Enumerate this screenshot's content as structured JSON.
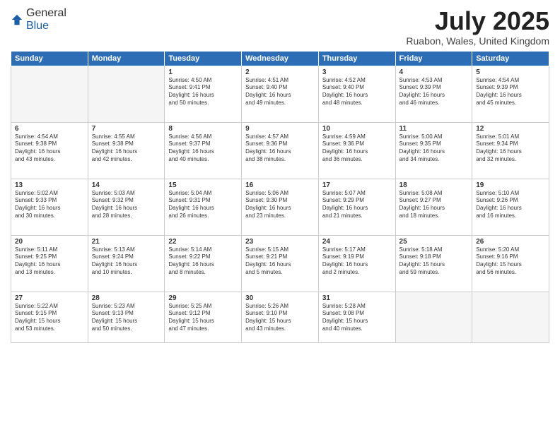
{
  "header": {
    "logo_general": "General",
    "logo_blue": "Blue",
    "title": "July 2025",
    "subtitle": "Ruabon, Wales, United Kingdom"
  },
  "days_of_week": [
    "Sunday",
    "Monday",
    "Tuesday",
    "Wednesday",
    "Thursday",
    "Friday",
    "Saturday"
  ],
  "weeks": [
    [
      {
        "day": "",
        "info": ""
      },
      {
        "day": "",
        "info": ""
      },
      {
        "day": "1",
        "info": "Sunrise: 4:50 AM\nSunset: 9:41 PM\nDaylight: 16 hours\nand 50 minutes."
      },
      {
        "day": "2",
        "info": "Sunrise: 4:51 AM\nSunset: 9:40 PM\nDaylight: 16 hours\nand 49 minutes."
      },
      {
        "day": "3",
        "info": "Sunrise: 4:52 AM\nSunset: 9:40 PM\nDaylight: 16 hours\nand 48 minutes."
      },
      {
        "day": "4",
        "info": "Sunrise: 4:53 AM\nSunset: 9:39 PM\nDaylight: 16 hours\nand 46 minutes."
      },
      {
        "day": "5",
        "info": "Sunrise: 4:54 AM\nSunset: 9:39 PM\nDaylight: 16 hours\nand 45 minutes."
      }
    ],
    [
      {
        "day": "6",
        "info": "Sunrise: 4:54 AM\nSunset: 9:38 PM\nDaylight: 16 hours\nand 43 minutes."
      },
      {
        "day": "7",
        "info": "Sunrise: 4:55 AM\nSunset: 9:38 PM\nDaylight: 16 hours\nand 42 minutes."
      },
      {
        "day": "8",
        "info": "Sunrise: 4:56 AM\nSunset: 9:37 PM\nDaylight: 16 hours\nand 40 minutes."
      },
      {
        "day": "9",
        "info": "Sunrise: 4:57 AM\nSunset: 9:36 PM\nDaylight: 16 hours\nand 38 minutes."
      },
      {
        "day": "10",
        "info": "Sunrise: 4:59 AM\nSunset: 9:36 PM\nDaylight: 16 hours\nand 36 minutes."
      },
      {
        "day": "11",
        "info": "Sunrise: 5:00 AM\nSunset: 9:35 PM\nDaylight: 16 hours\nand 34 minutes."
      },
      {
        "day": "12",
        "info": "Sunrise: 5:01 AM\nSunset: 9:34 PM\nDaylight: 16 hours\nand 32 minutes."
      }
    ],
    [
      {
        "day": "13",
        "info": "Sunrise: 5:02 AM\nSunset: 9:33 PM\nDaylight: 16 hours\nand 30 minutes."
      },
      {
        "day": "14",
        "info": "Sunrise: 5:03 AM\nSunset: 9:32 PM\nDaylight: 16 hours\nand 28 minutes."
      },
      {
        "day": "15",
        "info": "Sunrise: 5:04 AM\nSunset: 9:31 PM\nDaylight: 16 hours\nand 26 minutes."
      },
      {
        "day": "16",
        "info": "Sunrise: 5:06 AM\nSunset: 9:30 PM\nDaylight: 16 hours\nand 23 minutes."
      },
      {
        "day": "17",
        "info": "Sunrise: 5:07 AM\nSunset: 9:29 PM\nDaylight: 16 hours\nand 21 minutes."
      },
      {
        "day": "18",
        "info": "Sunrise: 5:08 AM\nSunset: 9:27 PM\nDaylight: 16 hours\nand 18 minutes."
      },
      {
        "day": "19",
        "info": "Sunrise: 5:10 AM\nSunset: 9:26 PM\nDaylight: 16 hours\nand 16 minutes."
      }
    ],
    [
      {
        "day": "20",
        "info": "Sunrise: 5:11 AM\nSunset: 9:25 PM\nDaylight: 16 hours\nand 13 minutes."
      },
      {
        "day": "21",
        "info": "Sunrise: 5:13 AM\nSunset: 9:24 PM\nDaylight: 16 hours\nand 10 minutes."
      },
      {
        "day": "22",
        "info": "Sunrise: 5:14 AM\nSunset: 9:22 PM\nDaylight: 16 hours\nand 8 minutes."
      },
      {
        "day": "23",
        "info": "Sunrise: 5:15 AM\nSunset: 9:21 PM\nDaylight: 16 hours\nand 5 minutes."
      },
      {
        "day": "24",
        "info": "Sunrise: 5:17 AM\nSunset: 9:19 PM\nDaylight: 16 hours\nand 2 minutes."
      },
      {
        "day": "25",
        "info": "Sunrise: 5:18 AM\nSunset: 9:18 PM\nDaylight: 15 hours\nand 59 minutes."
      },
      {
        "day": "26",
        "info": "Sunrise: 5:20 AM\nSunset: 9:16 PM\nDaylight: 15 hours\nand 56 minutes."
      }
    ],
    [
      {
        "day": "27",
        "info": "Sunrise: 5:22 AM\nSunset: 9:15 PM\nDaylight: 15 hours\nand 53 minutes."
      },
      {
        "day": "28",
        "info": "Sunrise: 5:23 AM\nSunset: 9:13 PM\nDaylight: 15 hours\nand 50 minutes."
      },
      {
        "day": "29",
        "info": "Sunrise: 5:25 AM\nSunset: 9:12 PM\nDaylight: 15 hours\nand 47 minutes."
      },
      {
        "day": "30",
        "info": "Sunrise: 5:26 AM\nSunset: 9:10 PM\nDaylight: 15 hours\nand 43 minutes."
      },
      {
        "day": "31",
        "info": "Sunrise: 5:28 AM\nSunset: 9:08 PM\nDaylight: 15 hours\nand 40 minutes."
      },
      {
        "day": "",
        "info": ""
      },
      {
        "day": "",
        "info": ""
      }
    ]
  ]
}
